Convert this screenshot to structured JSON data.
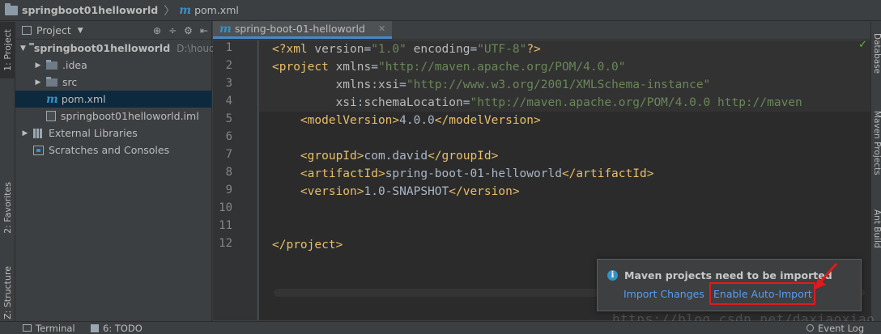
{
  "breadcrumb": {
    "project": "springboot01helloworld",
    "file": "pom.xml"
  },
  "left_tabs": {
    "project": "1: Project",
    "favorites": "2: Favorites",
    "structure": "Z: Structure"
  },
  "project_panel": {
    "header": "Project",
    "tree": [
      {
        "label": "springboot01helloworld",
        "hint": "D:\\houdu",
        "expanded": true,
        "icon": "folder-icon"
      },
      {
        "label": ".idea",
        "expanded": false,
        "icon": "folder-icon"
      },
      {
        "label": "src",
        "expanded": false,
        "icon": "folder-icon"
      },
      {
        "label": "pom.xml",
        "icon": "maven-icon",
        "selected": true
      },
      {
        "label": "springboot01helloworld.iml",
        "icon": "module-file-icon"
      },
      {
        "label": "External Libraries",
        "expanded": false,
        "icon": "library-icon"
      },
      {
        "label": "Scratches and Consoles",
        "icon": "scratch-icon"
      }
    ]
  },
  "editor": {
    "tab_label": "spring-boot-01-helloworld",
    "line_numbers": [
      "1",
      "2",
      "3",
      "4",
      "5",
      "6",
      "7",
      "8",
      "9",
      "10",
      "11",
      "12"
    ],
    "lines": {
      "l1": {
        "open": "<?xml ",
        "attr1": "version",
        "eq1": "=",
        "val1": "\"1.0\"",
        "sp": " ",
        "attr2": "encoding",
        "eq2": "=",
        "val2": "\"UTF-8\"",
        "close": "?>"
      },
      "l2": {
        "open": "<project ",
        "attr": "xmlns",
        "eq": "=",
        "val": "\"http://maven.apache.org/POM/4.0.0\""
      },
      "l3": {
        "indent": "         ",
        "prefix": "xmlns",
        "colon": ":",
        "attr": "xsi",
        "eq": "=",
        "val": "\"http://www.w3.org/2001/XMLSchema-instance\""
      },
      "l4": {
        "indent": "         ",
        "prefix": "xsi",
        "colon": ":",
        "attr": "schemaLocation",
        "eq": "=",
        "val": "\"http://maven.apache.org/POM/4.0.0 http://maven"
      },
      "l5": {
        "indent": "    ",
        "open": "<modelVersion>",
        "text": "4.0.0",
        "close": "</modelVersion>"
      },
      "l7": {
        "indent": "    ",
        "open": "<groupId>",
        "text": "com.david",
        "close": "</groupId>"
      },
      "l8": {
        "indent": "    ",
        "open": "<artifactId>",
        "text": "spring-boot-01-helloworld",
        "close": "</artifactId>"
      },
      "l9": {
        "indent": "    ",
        "open": "<version>",
        "text": "1.0-SNAPSHOT",
        "close": "</version>"
      },
      "l12": {
        "close": "</project>"
      }
    }
  },
  "right_tabs": {
    "database": "Database",
    "maven": "Maven Projects",
    "ant": "Ant Build"
  },
  "notification": {
    "message": "Maven projects need to be imported",
    "import_changes": "Import Changes",
    "enable_auto_import": "Enable Auto-Import"
  },
  "watermark": "https://blog.csdn.net/daxiaoxiao",
  "bottom_bar": {
    "terminal": "Terminal",
    "todo": "6: TODO",
    "event_log": "Event Log"
  },
  "colors": {
    "tag": "#e8bf6a",
    "attr_value": "#6a8759",
    "link": "#589df6",
    "highlight_box": "#e11a1a"
  }
}
